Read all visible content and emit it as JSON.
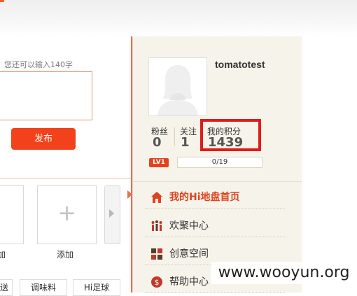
{
  "compose": {
    "remaining_text": "您还可以输入",
    "remaining_count": "140字",
    "publish_label": "发布"
  },
  "tiles": {
    "caption_a": "加",
    "caption_b": "添加"
  },
  "tags": [
    "送",
    "调味料",
    "Hi足球"
  ],
  "profile": {
    "username": "tomatotest",
    "stats": {
      "fans_label": "粉丝",
      "fans_value": "0",
      "follow_label": "关注",
      "follow_value": "1",
      "points_label": "我的积分",
      "points_value": "1439"
    },
    "level": "LV1",
    "progress_text": "0/19",
    "progress_fraction": 0.0
  },
  "menu": [
    {
      "label": "我的Hi地盘首页",
      "icon": "house-icon"
    },
    {
      "label": "欢聚中心",
      "icon": "people-icon"
    },
    {
      "label": "创意空间",
      "icon": "puzzle-icon"
    },
    {
      "label": "帮助中心",
      "icon": "help-icon"
    }
  ],
  "watermark": "www.wooyun.org",
  "colors": {
    "accent": "#f2421b",
    "highlight": "#e01b1b",
    "panel_bg": "#f6f3ea"
  }
}
